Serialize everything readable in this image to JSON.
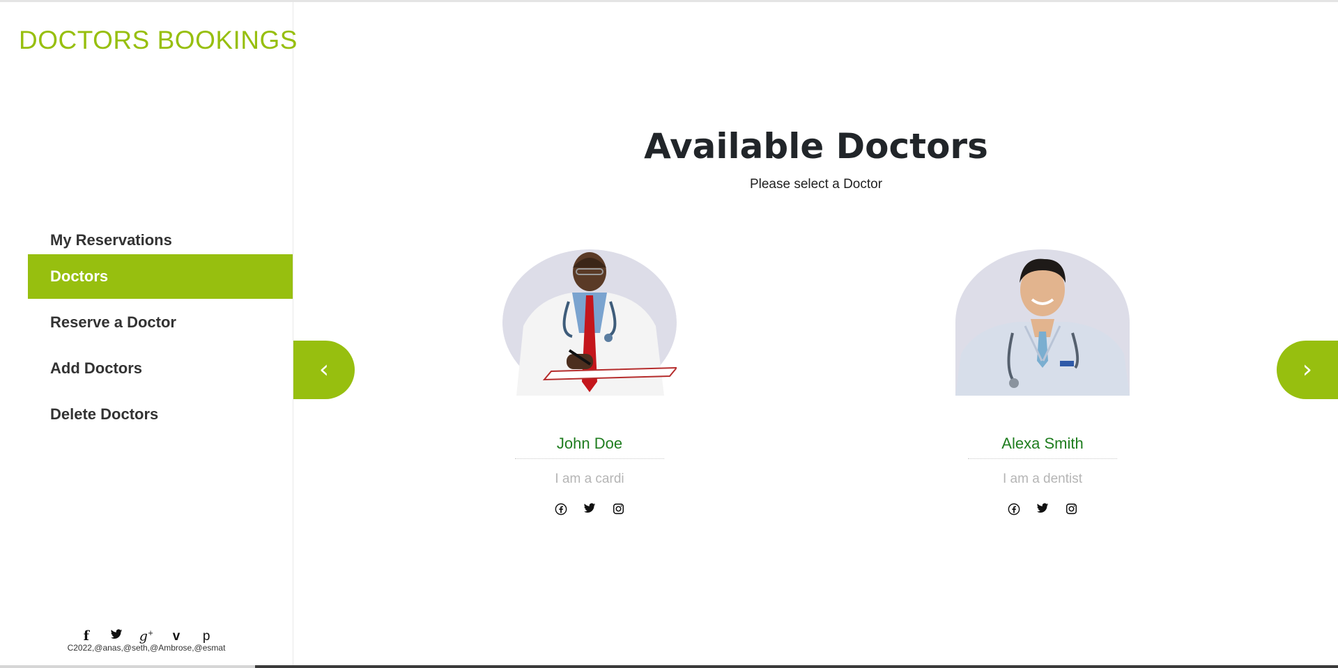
{
  "brand": "DOCTORS BOOKINGS",
  "nav": [
    {
      "label": "My Reservations",
      "active": false
    },
    {
      "label": "Doctors",
      "active": true
    },
    {
      "label": "Reserve a Doctor",
      "active": false
    },
    {
      "label": "Add Doctors",
      "active": false
    },
    {
      "label": "Delete Doctors",
      "active": false
    }
  ],
  "footer": {
    "social_icons": [
      "facebook-icon",
      "twitter-icon",
      "google-plus-icon",
      "vimeo-icon",
      "pinterest-icon"
    ],
    "copyright": "C2022,@anas,@seth,@Ambrose,@esmat"
  },
  "main": {
    "title": "Available Doctors",
    "subtitle": "Please select a Doctor",
    "prev_arrow": "‹",
    "next_arrow": "›"
  },
  "doctors": [
    {
      "name": "John Doe",
      "description": "I am a cardi",
      "social_icons": [
        "facebook-icon",
        "twitter-icon",
        "instagram-icon"
      ]
    },
    {
      "name": "Alexa Smith",
      "description": "I am a dentist",
      "social_icons": [
        "facebook-icon",
        "twitter-icon",
        "instagram-icon"
      ]
    }
  ],
  "colors": {
    "accent": "#97bf0f",
    "doctor_name": "#1f7d1f",
    "portrait_bg": "#dddde8"
  }
}
